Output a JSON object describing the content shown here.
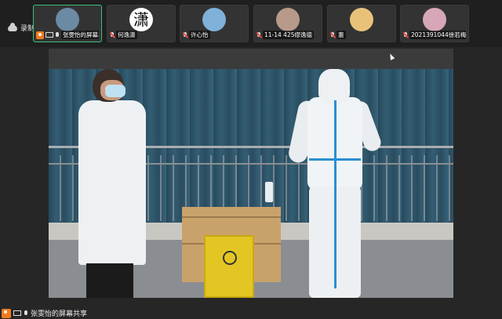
{
  "recording": {
    "label": "录制中"
  },
  "participants": [
    {
      "name": "张雯怡的屏幕共享",
      "avatar_color": "#6b8aa3",
      "active": true,
      "mic": "on",
      "sharing": true
    },
    {
      "name": "何逸潇",
      "avatar_color": "#ffffff",
      "avatar_text": "潇",
      "mic": "off"
    },
    {
      "name": "许心怡",
      "avatar_color": "#7fb1d9",
      "mic": "off"
    },
    {
      "name": "11-14 425缪逸德",
      "avatar_color": "#b89a8a",
      "mic": "off"
    },
    {
      "name": "惠",
      "avatar_color": "#e9c27a",
      "mic": "off"
    },
    {
      "name": "2021391044徐若梅",
      "avatar_color": "#d7a6b8",
      "mic": "off"
    }
  ],
  "footer": {
    "share_label": "张雯怡的屏幕共享"
  },
  "colors": {
    "accent_active": "#39c07a",
    "badge": "#f07b1d",
    "mic_off": "#e04848"
  }
}
